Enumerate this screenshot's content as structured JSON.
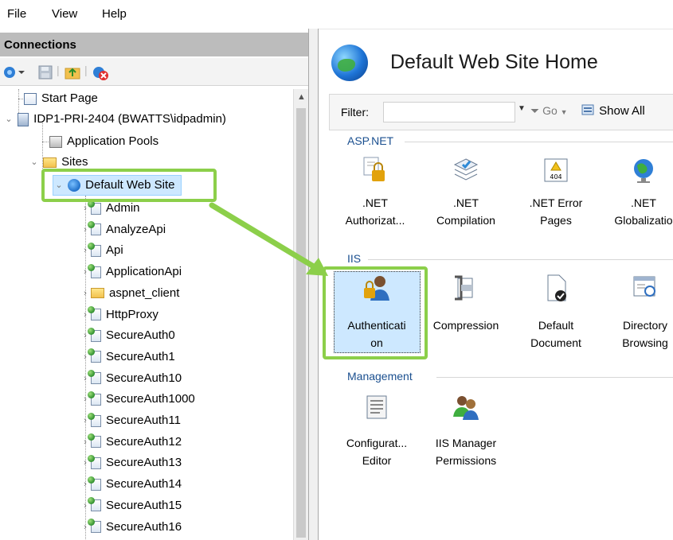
{
  "menu": [
    "File",
    "View",
    "Help"
  ],
  "connections": {
    "title": "Connections",
    "toolbar_icons": [
      "connect-icon",
      "save-icon",
      "up-folder-icon",
      "disconnect-icon"
    ]
  },
  "tree": {
    "start_page": "Start Page",
    "server": "IDP1-PRI-2404 (BWATTS\\idpadmin)",
    "app_pools": "Application Pools",
    "sites": "Sites",
    "default_site": "Default Web Site",
    "apps": [
      "Admin",
      "AnalyzeApi",
      "Api",
      "ApplicationApi",
      "aspnet_client",
      "HttpProxy",
      "SecureAuth0",
      "SecureAuth1",
      "SecureAuth10",
      "SecureAuth1000",
      "SecureAuth11",
      "SecureAuth12",
      "SecureAuth13",
      "SecureAuth14",
      "SecureAuth15",
      "SecureAuth16"
    ]
  },
  "main": {
    "title": "Default Web Site Home",
    "filter_label": "Filter:",
    "go_label": "Go",
    "show_all_label": "Show All",
    "groups": {
      "aspnet": "ASP.NET",
      "iis": "IIS",
      "management": "Management"
    },
    "features_aspnet": [
      {
        "line1": ".NET",
        "line2": "Authorizat..."
      },
      {
        "line1": ".NET",
        "line2": "Compilation"
      },
      {
        "line1": ".NET Error",
        "line2": "Pages"
      },
      {
        "line1": ".NET",
        "line2": "Globalizatio"
      }
    ],
    "features_iis": [
      {
        "line1": "Authenticati",
        "line2": "on"
      },
      {
        "line1": "Compression",
        "line2": ""
      },
      {
        "line1": "Default",
        "line2": "Document"
      },
      {
        "line1": "Directory",
        "line2": "Browsing"
      }
    ],
    "features_management": [
      {
        "line1": "Configurat...",
        "line2": "Editor"
      },
      {
        "line1": "IIS Manager",
        "line2": "Permissions"
      }
    ],
    "error_icon_text": "404"
  },
  "colors": {
    "highlight": "#8ccf4a",
    "selection": "#cde8ff",
    "group_text": "#1a4f8f"
  }
}
